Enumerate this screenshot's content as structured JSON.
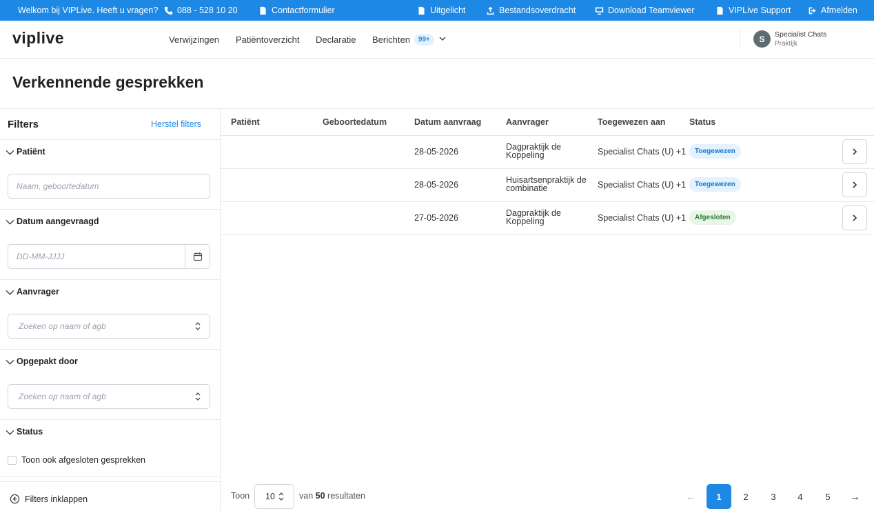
{
  "topbar": {
    "welcome": "Welkom bij VIPLive. Heeft u vragen?",
    "phone": "088 - 528 10 20",
    "contact": "Contactformulier",
    "featured": "Uitgelicht",
    "transfer": "Bestandsoverdracht",
    "teamviewer": "Download Teamviewer",
    "support": "VIPLive Support",
    "logout": "Afmelden"
  },
  "header": {
    "logo": "viplive",
    "nav": [
      "Verwijzingen",
      "Patiëntoverzicht",
      "Declaratie",
      "Berichten"
    ],
    "messages_badge": "99+",
    "user_initial": "S",
    "user_name": "Specialist Chats",
    "user_role": "Praktijk"
  },
  "page": {
    "title": "Verkennende gesprekken"
  },
  "filters": {
    "title": "Filters",
    "reset": "Herstel filters",
    "patient_label": "Patiënt",
    "patient_placeholder": "Naam, geboortedatum",
    "date_label": "Datum aangevraagd",
    "date_placeholder": "DD-MM-JJJJ",
    "requester_label": "Aanvrager",
    "requester_placeholder": "Zoeken op naam of agb",
    "picked_label": "Opgepakt door",
    "picked_placeholder": "Zoeken op naam of agb",
    "status_label": "Status",
    "closed_checkbox": "Toon ook afgesloten gesprekken",
    "collapse": "Filters inklappen"
  },
  "table": {
    "headers": [
      "Patiënt",
      "Geboortedatum",
      "Datum aanvraag",
      "Aanvrager",
      "Toegewezen aan",
      "Status"
    ],
    "rows": [
      {
        "patient": "",
        "birthdate": "",
        "date": "28-05-2026",
        "requester": "Dagpraktijk de Koppeling",
        "assigned": "Specialist Chats (U) +1",
        "status": "Toegewezen",
        "status_color": "#1976d2"
      },
      {
        "patient": "",
        "birthdate": "",
        "date": "28-05-2026",
        "requester": "Huisartsenpraktijk de combinatie",
        "assigned": "Specialist Chats (U) +1",
        "status": "Toegewezen",
        "status_color": "#1976d2"
      },
      {
        "patient": "",
        "birthdate": "",
        "date": "27-05-2026",
        "requester": "Dagpraktijk de Koppeling",
        "assigned": "Specialist Chats (U) +1",
        "status": "Afgesloten",
        "status_color": "#2e7d32"
      }
    ]
  },
  "pagination": {
    "show_label": "Toon",
    "per_page": "10",
    "results_prefix": "van",
    "results_count": "50",
    "results_suffix": "resultaten",
    "pages": [
      "1",
      "2",
      "3",
      "4",
      "5"
    ],
    "current_page": "1",
    "accent": "#1e88e5"
  }
}
